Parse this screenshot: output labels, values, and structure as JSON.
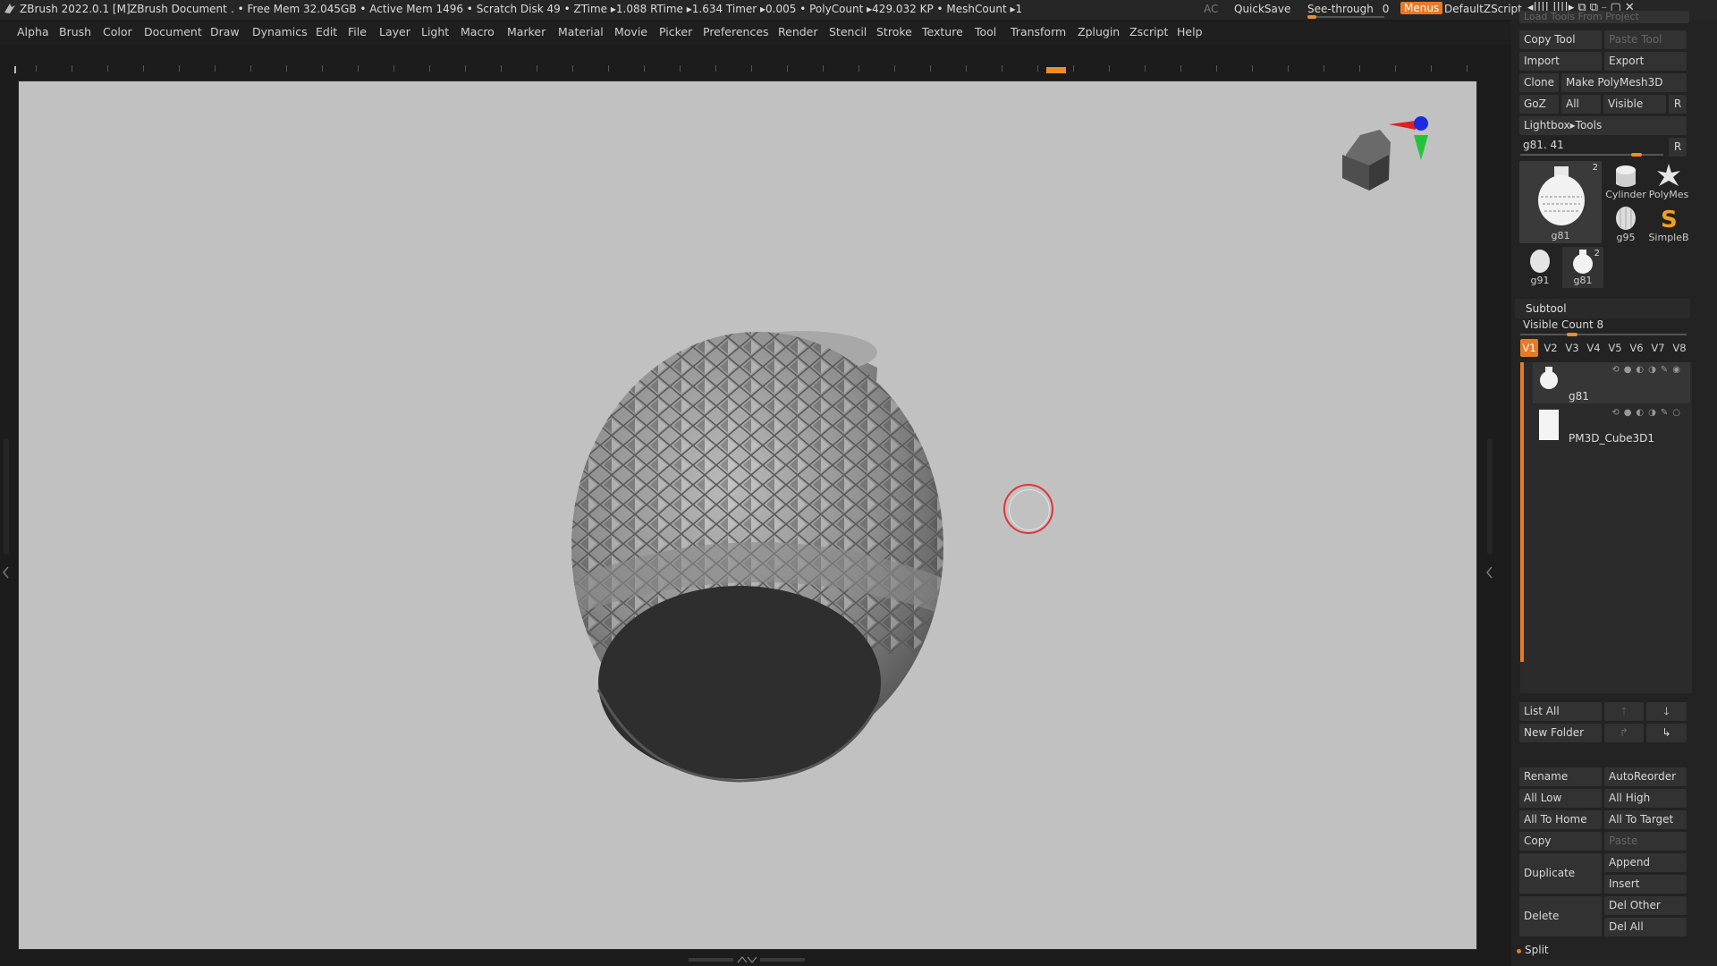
{
  "titlebar": {
    "app": "ZBrush 2022.0.1 [M]",
    "document": "ZBrush Document",
    "stats": ". • Free Mem 32.045GB • Active Mem 1496 • Scratch Disk 49 •  ZTime ▸1.088 RTime ▸1.634 Timer ▸0.005 • PolyCount ▸429.032 KP  • MeshCount ▸1",
    "ac": "AC",
    "quicksave": "QuickSave",
    "seethrough_label": "See-through",
    "seethrough_value": "0",
    "menus": "Menus",
    "script": "DefaultZScript",
    "win_icons": "◂||||  ||||▸   ⧉  ⧉     ⎯    ▢   ✕"
  },
  "menubar": [
    "Alpha",
    "Brush",
    "Color",
    "Document",
    "Draw",
    "Dynamics",
    "Edit",
    "File",
    "Layer",
    "Light",
    "Macro",
    "Marker",
    "Material",
    "Movie",
    "Picker",
    "Preferences",
    "Render",
    "Stencil",
    "Stroke",
    "Texture",
    "Tool",
    "Transform",
    "Zplugin",
    "Zscript",
    "Help"
  ],
  "tool_panel": {
    "load_tools_from_project": "Load Tools From Project",
    "copy_tool": "Copy Tool",
    "paste_tool": "Paste Tool",
    "import": "Import",
    "export": "Export",
    "clone": "Clone",
    "make_polymesh": "Make PolyMesh3D",
    "goz": "GoZ",
    "all": "All",
    "visible": "Visible",
    "r": "R",
    "lightbox_tools": "Lightbox▸Tools",
    "current_tool": "g81. 41",
    "current_tool_r": "R",
    "thumbs": [
      {
        "label": "g81",
        "count": "2"
      },
      {
        "label": "Cylinder",
        "count": ""
      },
      {
        "label": "PolyMes",
        "count": ""
      },
      {
        "label": "g95",
        "count": ""
      },
      {
        "label": "SimpleB",
        "count": ""
      },
      {
        "label": "g91",
        "count": ""
      },
      {
        "label": "g81",
        "count": "2"
      }
    ]
  },
  "subtool": {
    "title": "Subtool",
    "visible_count": "Visible Count 8",
    "tabs": [
      "V1",
      "V2",
      "V3",
      "V4",
      "V5",
      "V6",
      "V7",
      "V8"
    ],
    "items": [
      {
        "name": "g81"
      },
      {
        "name": "PM3D_Cube3D1"
      }
    ],
    "list_all": "List All",
    "new_folder": "New Folder",
    "rename": "Rename",
    "autoreorder": "AutoReorder",
    "all_low": "All Low",
    "all_high": "All High",
    "all_to_home": "All To Home",
    "all_to_target": "All To Target",
    "copy": "Copy",
    "paste": "Paste",
    "duplicate": "Duplicate",
    "append": "Append",
    "insert": "Insert",
    "delete": "Delete",
    "del_other": "Del Other",
    "del_all": "Del All",
    "split": "Split"
  },
  "colors": {
    "accent": "#e77a25",
    "viewport": "#c1c1c1",
    "panel": "#232323"
  }
}
